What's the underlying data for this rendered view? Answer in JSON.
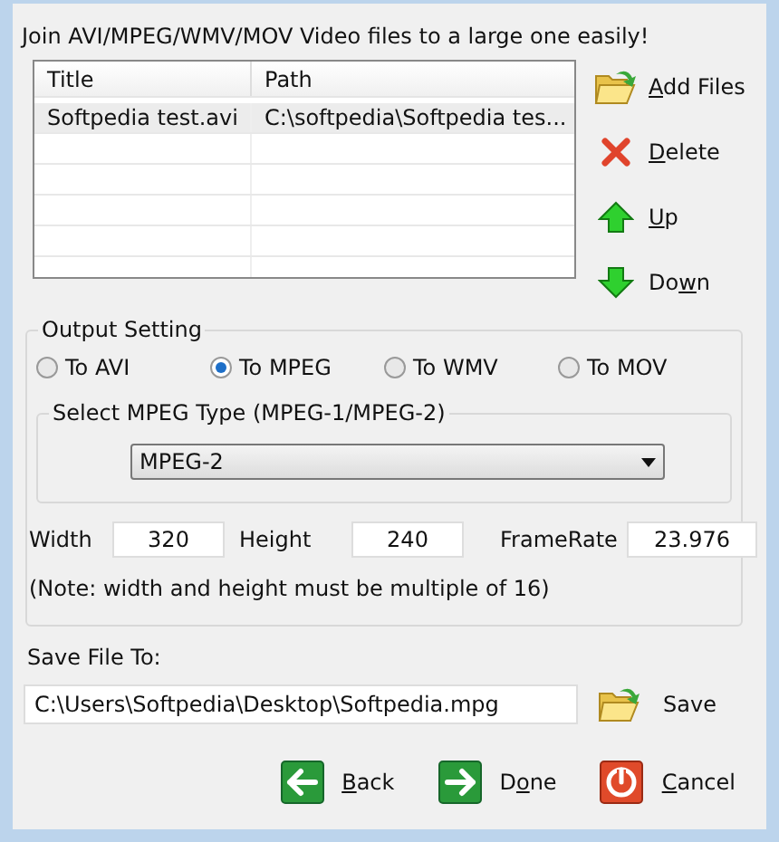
{
  "heading": "Join AVI/MPEG/WMV/MOV  Video files to a large one easily!",
  "file_list": {
    "columns": [
      "Title",
      "Path"
    ],
    "rows": [
      {
        "cells": [
          "Softpedia test.avi",
          "C:\\softpedia\\Softpedia tes..."
        ],
        "selected": true
      }
    ]
  },
  "side_buttons": [
    {
      "kind": "add",
      "label": {
        "key": "A",
        "after": "dd Files"
      }
    },
    {
      "kind": "delete",
      "label": {
        "key": "D",
        "after": "elete"
      }
    },
    {
      "kind": "up",
      "label": {
        "key": "U",
        "after": "p"
      }
    },
    {
      "kind": "down",
      "label": {
        "before": "Do",
        "key": "w",
        "after": "n"
      }
    }
  ],
  "output_setting": {
    "title": "Output Setting",
    "formats": [
      {
        "label": "To AVI",
        "selected": false
      },
      {
        "label": "To MPEG",
        "selected": true
      },
      {
        "label": "To WMV",
        "selected": false
      },
      {
        "label": "To MOV",
        "selected": false
      }
    ],
    "mpeg_type": {
      "title": "Select MPEG Type (MPEG-1/MPEG-2)",
      "value": "MPEG-2"
    },
    "fields": [
      {
        "label": "Width",
        "value": "320"
      },
      {
        "label": "Height",
        "value": "240"
      },
      {
        "label": "FrameRate",
        "value": "23.976"
      }
    ],
    "note": "(Note: width and height must be multiple of 16)"
  },
  "save": {
    "label": "Save File To:",
    "value": "C:\\Users\\Softpedia\\Desktop\\Softpedia.mpg",
    "button": "Save"
  },
  "bottom_buttons": [
    {
      "kind": "back",
      "label": {
        "key": "B",
        "after": "ack"
      }
    },
    {
      "kind": "done",
      "label": {
        "before": "D",
        "key": "o",
        "after": "ne"
      }
    },
    {
      "kind": "cancel",
      "label": {
        "key": "C",
        "after": "ancel"
      }
    }
  ]
}
